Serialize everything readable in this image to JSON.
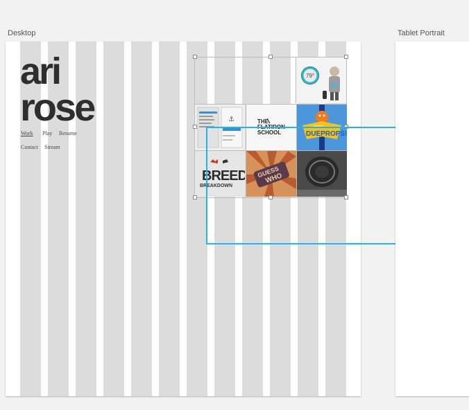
{
  "artboards": {
    "desktop": {
      "title": "Desktop"
    },
    "tablet": {
      "title": "Tablet Portrait"
    }
  },
  "site": {
    "logo": {
      "line1": "ari",
      "line2": "rose"
    },
    "nav": {
      "work": "Work",
      "play": "Play",
      "resume": "Resume",
      "contact": "Contact",
      "stream": "Stream"
    }
  },
  "tiles": {
    "weather_temp": "79°",
    "flatiron": {
      "line1": "THE",
      "line2": "FLATIRON",
      "line3": "SCHOOL"
    },
    "dueprops": {
      "top": "MORE",
      "main": "DUEPROPS!"
    },
    "breed": {
      "line1": "BREED",
      "line2": "BREAKDOWN"
    },
    "guess_who": {
      "line1": "GUESS",
      "line2": "WHO"
    }
  },
  "colors": {
    "selection": "#22b4e8",
    "column": "#dcdcdc",
    "canvas": "#f2f2f2"
  }
}
